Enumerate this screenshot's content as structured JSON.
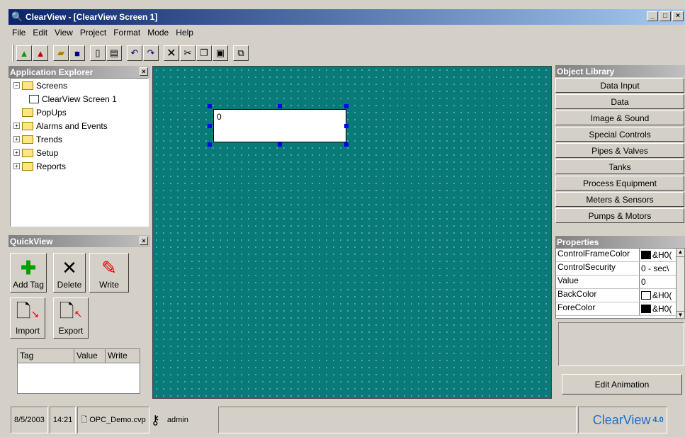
{
  "window": {
    "title": "ClearView - [ClearView Screen 1]",
    "min": "_",
    "max": "□",
    "close": "×"
  },
  "menu": [
    "File",
    "Edit",
    "View",
    "Project",
    "Format",
    "Mode",
    "Help"
  ],
  "explorer": {
    "title": "Application Explorer",
    "tree": [
      {
        "label": "Screens",
        "toggle": "−",
        "level": 0
      },
      {
        "label": "ClearView Screen 1",
        "toggle": "",
        "level": 1
      },
      {
        "label": "PopUps",
        "toggle": "",
        "level": 0
      },
      {
        "label": "Alarms and Events",
        "toggle": "+",
        "level": 0
      },
      {
        "label": "Trends",
        "toggle": "+",
        "level": 0
      },
      {
        "label": "Setup",
        "toggle": "+",
        "level": 0
      },
      {
        "label": "Reports",
        "toggle": "+",
        "level": 0
      }
    ]
  },
  "quickview": {
    "title": "QuickView",
    "buttons": [
      {
        "label": "Add Tag",
        "icon": "✚",
        "color": "#00a000"
      },
      {
        "label": "Delete",
        "icon": "✕",
        "color": "#000000"
      },
      {
        "label": "Write",
        "icon": "✎",
        "color": "#e00000"
      },
      {
        "label": "Import",
        "icon": "🗋",
        "color": "#000000"
      },
      {
        "label": "Export",
        "icon": "🗋",
        "color": "#000000"
      }
    ],
    "table_headers": [
      "Tag",
      "Value",
      "Write"
    ]
  },
  "canvas": {
    "control_value": "0"
  },
  "library": {
    "title": "Object Library",
    "buttons": [
      "Data Input",
      "Data",
      "Image & Sound",
      "Special Controls",
      "Pipes & Valves",
      "Tanks",
      "Process Equipment",
      "Meters & Sensors",
      "Pumps & Motors"
    ]
  },
  "properties": {
    "title": "Properties",
    "rows": [
      {
        "name": "ControlFrameColor",
        "value": "&H0(",
        "swatch": "#000000"
      },
      {
        "name": "ControlSecurity",
        "value": "0 - sec\\",
        "swatch": ""
      },
      {
        "name": "Value",
        "value": "0",
        "swatch": ""
      },
      {
        "name": "BackColor",
        "value": "&H0(",
        "swatch": "#ffffff"
      },
      {
        "name": "ForeColor",
        "value": "&H0(",
        "swatch": "#000000"
      }
    ],
    "edit_animation": "Edit Animation"
  },
  "status": {
    "date": "8/5/2003",
    "time": "14:21",
    "file": "OPC_Demo.cvp",
    "user": "admin",
    "brand": "ClearView",
    "version": "4.0"
  },
  "colors": {
    "canvas": "#0a7a78",
    "title_start": "#0a246a",
    "brand": "#1f6fc0"
  }
}
